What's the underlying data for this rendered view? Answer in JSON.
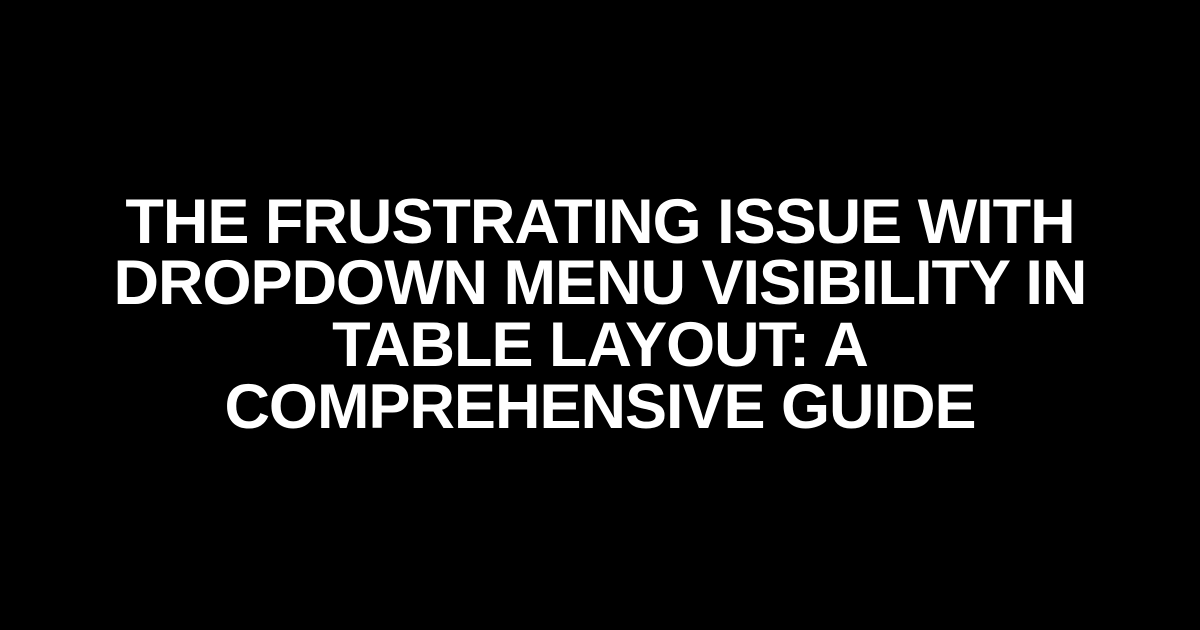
{
  "title": "THE FRUSTRATING ISSUE WITH DROPDOWN MENU VISIBILITY IN TABLE LAYOUT: A COMPREHENSIVE GUIDE"
}
